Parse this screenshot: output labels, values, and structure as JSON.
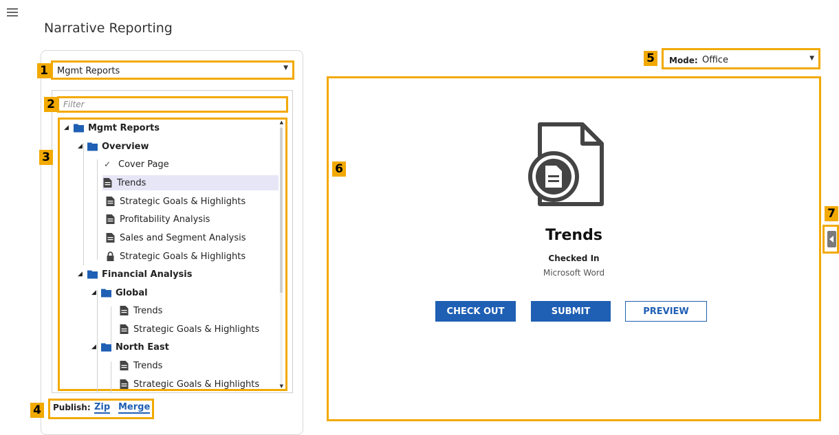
{
  "app": {
    "title": "Narrative Reporting"
  },
  "callouts": [
    "1",
    "2",
    "3",
    "4",
    "5",
    "6",
    "7"
  ],
  "library": {
    "selected": "Mgmt Reports"
  },
  "filter": {
    "placeholder": "Filter"
  },
  "tree": {
    "root": "Mgmt Reports",
    "overview": {
      "label": "Overview",
      "items": [
        "Cover Page",
        "Trends",
        "Strategic Goals & Highlights",
        "Profitability Analysis",
        "Sales and Segment Analysis",
        "Strategic Goals & Highlights"
      ]
    },
    "financial": {
      "label": "Financial Analysis",
      "global": {
        "label": "Global",
        "items": [
          "Trends",
          "Strategic Goals & Highlights"
        ]
      },
      "northeast": {
        "label": "North East",
        "items": [
          "Trends",
          "Strategic Goals & Highlights"
        ]
      }
    }
  },
  "publish": {
    "label": "Publish:",
    "zip": "Zip",
    "merge": "Merge"
  },
  "mode": {
    "label": "Mode:",
    "value": "Office"
  },
  "document": {
    "title": "Trends",
    "status": "Checked In",
    "app": "Microsoft Word",
    "buttons": {
      "check_out": "CHECK OUT",
      "submit": "SUBMIT",
      "preview": "PREVIEW"
    }
  },
  "colors": {
    "accent": "#f2a900",
    "primary": "#1f5fb4",
    "folder": "#1f5fb4",
    "selected_row": "#e6e6f7"
  }
}
